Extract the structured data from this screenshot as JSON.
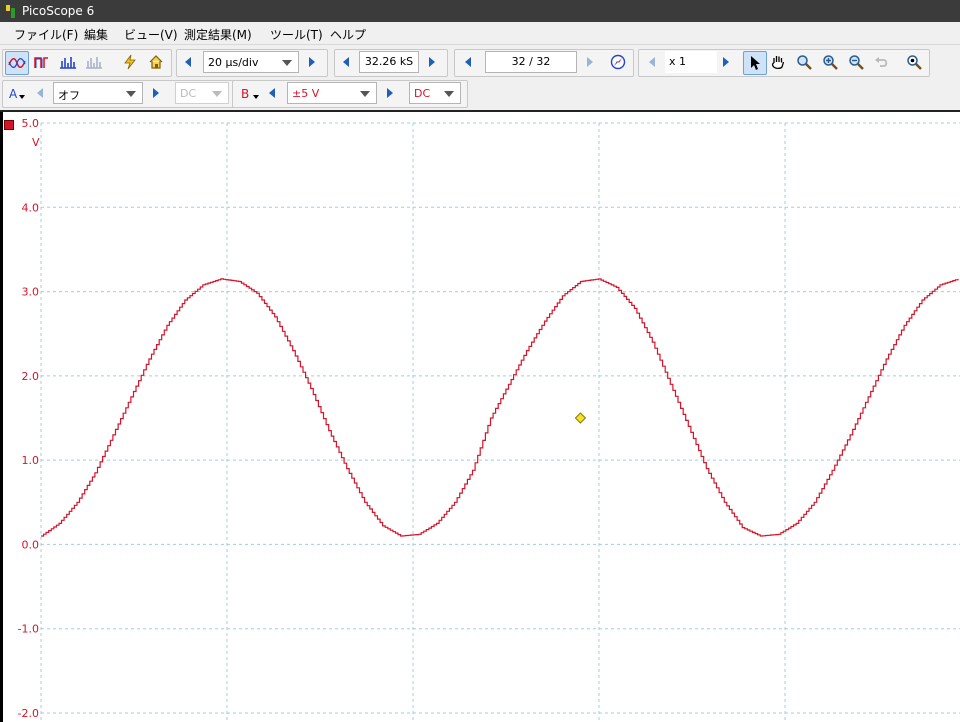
{
  "window": {
    "title": "PicoScope 6"
  },
  "menu": [
    {
      "label": "ファイル(F)"
    },
    {
      "label": "編集"
    },
    {
      "label": "ビュー(V)"
    },
    {
      "label": "測定結果(M)"
    },
    {
      "label": "ツール(T)"
    },
    {
      "label": "ヘルプ"
    }
  ],
  "toolbar": {
    "timebase": "20 µs/div",
    "samples": "32.26 kS",
    "buffer": "32 / 32",
    "zoom": "x 1",
    "icons": [
      "scope-mode-icon",
      "persistence-mode-icon",
      "spectrum-mode-icon",
      "spectrum-persistence-icon",
      "auto-setup-icon",
      "default-setup-icon",
      "compass-icon",
      "pointer-icon",
      "hand-icon",
      "zoom-icon",
      "zoom-in-icon",
      "zoom-out-icon",
      "undo-zoom-icon",
      "overview-icon"
    ]
  },
  "channelA": {
    "label": "A",
    "range": "オフ",
    "coupling": "DC",
    "color": "#2244cc"
  },
  "channelB": {
    "label": "B",
    "range": "±5 V",
    "coupling": "DC",
    "color": "#d4142a"
  },
  "chart_data": {
    "type": "line",
    "ylabel": "V",
    "ylim": [
      -2.0,
      5.0
    ],
    "yticks": [
      "5.0",
      "4.0",
      "3.0",
      "2.0",
      "1.0",
      "0.0",
      "-1.0",
      "-2.0"
    ],
    "grid": true,
    "series": [
      {
        "color": "#d4142a",
        "x": [
          0,
          10,
          20,
          30,
          40,
          50,
          60,
          70,
          80,
          90,
          100,
          110,
          120,
          130,
          140,
          150,
          160,
          170,
          180,
          190,
          200,
          210,
          220,
          230,
          240,
          250,
          260,
          270,
          280,
          290,
          300,
          310,
          320,
          330,
          340,
          350,
          360,
          370,
          380,
          390,
          400,
          410,
          420,
          430,
          440,
          450,
          460,
          470,
          480,
          490,
          500,
          510
        ],
        "y": [
          0.1,
          0.25,
          0.5,
          0.85,
          1.3,
          1.75,
          2.2,
          2.6,
          2.9,
          3.08,
          3.15,
          3.12,
          2.98,
          2.7,
          2.3,
          1.85,
          1.35,
          0.9,
          0.5,
          0.22,
          0.1,
          0.12,
          0.25,
          0.5,
          0.88,
          1.5,
          1.9,
          2.3,
          2.65,
          2.95,
          3.12,
          3.15,
          3.05,
          2.8,
          2.4,
          1.9,
          1.4,
          0.9,
          0.5,
          0.2,
          0.1,
          0.12,
          0.25,
          0.5,
          0.88,
          1.3,
          1.75,
          2.2,
          2.6,
          2.9,
          3.08,
          3.15
        ]
      }
    ],
    "trigger": {
      "x": 300,
      "y": 1.5
    }
  }
}
